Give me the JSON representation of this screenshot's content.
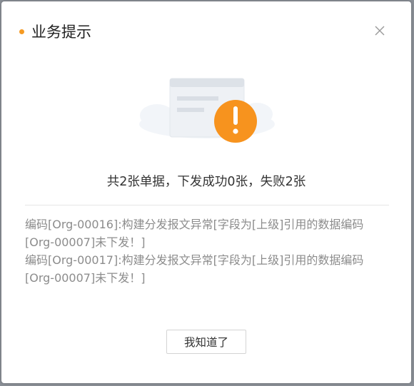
{
  "dialog": {
    "title": "业务提示",
    "close_icon": "close-icon",
    "alert_icon": "warning-exclamation-icon",
    "accent_color": "#f59a23",
    "summary": "共2张单据，下发成功0张，失败2张",
    "details": [
      "编码[Org-00016]:构建分发报文异常[字段为[上级]引用的数据编码[Org-00007]未下发！]",
      "编码[Org-00017]:构建分发报文异常[字段为[上级]引用的数据编码[Org-00007]未下发！]"
    ],
    "confirm_label": "我知道了"
  }
}
